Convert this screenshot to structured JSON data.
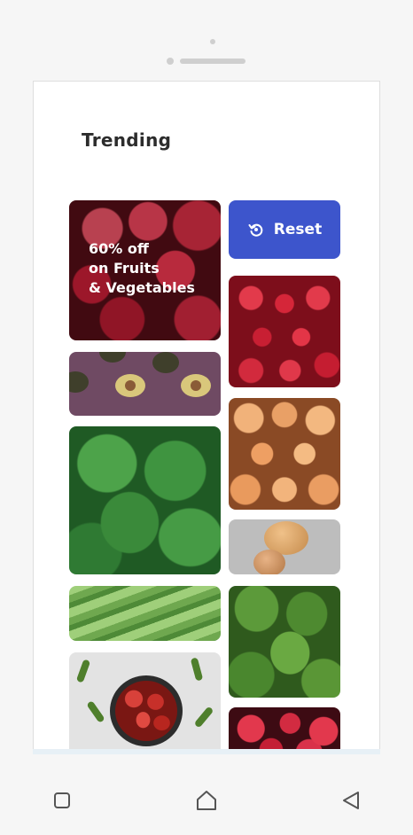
{
  "screen": {
    "title": "Trending"
  },
  "promo": {
    "line1": "60% off",
    "line2": "on Fruits",
    "line3": "& Vegetables"
  },
  "reset_button": {
    "label": "Reset",
    "icon": "reset-icon",
    "color": "#3d55cc"
  },
  "tiles": [
    {
      "name": "strawberries"
    },
    {
      "name": "cherries"
    },
    {
      "name": "avocados-on-purple"
    },
    {
      "name": "apricots"
    },
    {
      "name": "spinach"
    },
    {
      "name": "onions"
    },
    {
      "name": "okra"
    },
    {
      "name": "green-avocados"
    },
    {
      "name": "chili-bowl"
    },
    {
      "name": "radishes"
    }
  ],
  "navbar": {
    "items": [
      "recents-square-icon",
      "home-icon",
      "back-triangle-icon"
    ]
  }
}
